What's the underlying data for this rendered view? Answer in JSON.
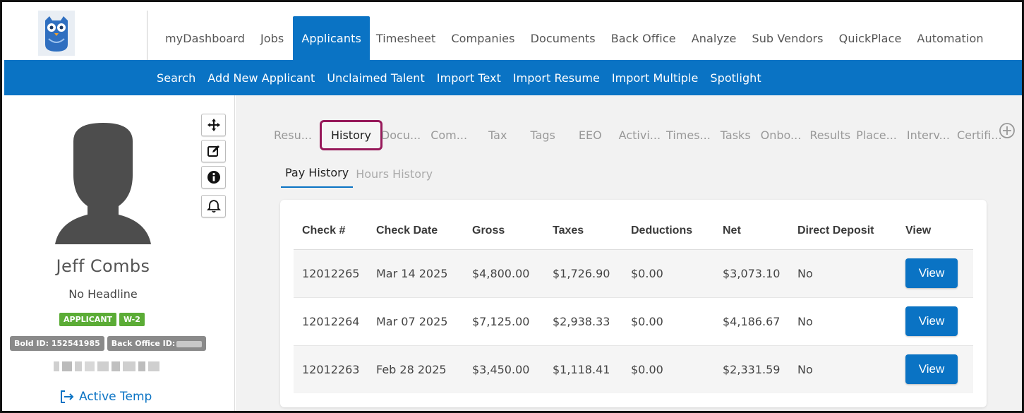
{
  "nav": {
    "items": [
      {
        "label": "myDashboard"
      },
      {
        "label": "Jobs"
      },
      {
        "label": "Applicants"
      },
      {
        "label": "Timesheet"
      },
      {
        "label": "Companies"
      },
      {
        "label": "Documents"
      },
      {
        "label": "Back Office"
      },
      {
        "label": "Analyze"
      },
      {
        "label": "Sub Vendors"
      },
      {
        "label": "QuickPlace"
      },
      {
        "label": "Automation"
      }
    ],
    "active": "Applicants"
  },
  "subnav": {
    "items": [
      {
        "label": "Search"
      },
      {
        "label": "Add New Applicant"
      },
      {
        "label": "Unclaimed Talent"
      },
      {
        "label": "Import Text"
      },
      {
        "label": "Import Resume"
      },
      {
        "label": "Import Multiple"
      },
      {
        "label": "Spotlight"
      }
    ]
  },
  "profile": {
    "name": "Jeff Combs",
    "headline": "No Headline",
    "badges": [
      "APPLICANT",
      "W-2"
    ],
    "bold_id_label": "Bold ID: 152541985",
    "back_office_id_label": "Back Office ID:",
    "status": "Active Temp",
    "tool_icons": [
      "move-icon",
      "edit-icon",
      "info-icon",
      "bell-icon"
    ]
  },
  "tabs": {
    "items": [
      {
        "label": "Resu..."
      },
      {
        "label": "History"
      },
      {
        "label": "Docu..."
      },
      {
        "label": "Com..."
      },
      {
        "label": "Tax"
      },
      {
        "label": "Tags"
      },
      {
        "label": "EEO"
      },
      {
        "label": "Activi..."
      },
      {
        "label": "Times..."
      },
      {
        "label": "Tasks"
      },
      {
        "label": "Onbo..."
      },
      {
        "label": "Results"
      },
      {
        "label": "Place..."
      },
      {
        "label": "Interv..."
      },
      {
        "label": "Certifi..."
      }
    ],
    "active": "History"
  },
  "subtabs": {
    "items": [
      {
        "label": "Pay History"
      },
      {
        "label": "Hours History"
      }
    ],
    "active": "Pay History"
  },
  "table": {
    "columns": [
      "Check #",
      "Check Date",
      "Gross",
      "Taxes",
      "Deductions",
      "Net",
      "Direct Deposit",
      "View"
    ],
    "rows": [
      {
        "check": "12012265",
        "date": "Mar 14 2025",
        "gross": "$4,800.00",
        "taxes": "$1,726.90",
        "deductions": "$0.00",
        "net": "$3,073.10",
        "direct_deposit": "No",
        "view": "View"
      },
      {
        "check": "12012264",
        "date": "Mar 07 2025",
        "gross": "$7,125.00",
        "taxes": "$2,938.33",
        "deductions": "$0.00",
        "net": "$4,186.67",
        "direct_deposit": "No",
        "view": "View"
      },
      {
        "check": "12012263",
        "date": "Feb 28 2025",
        "gross": "$3,450.00",
        "taxes": "$1,118.41",
        "deductions": "$0.00",
        "net": "$2,331.59",
        "direct_deposit": "No",
        "view": "View"
      }
    ]
  },
  "colors": {
    "brand_blue": "#0a73c4",
    "badge_green": "#5bac36",
    "badge_grey": "#8a8a8a",
    "highlight_border": "#97195a"
  }
}
